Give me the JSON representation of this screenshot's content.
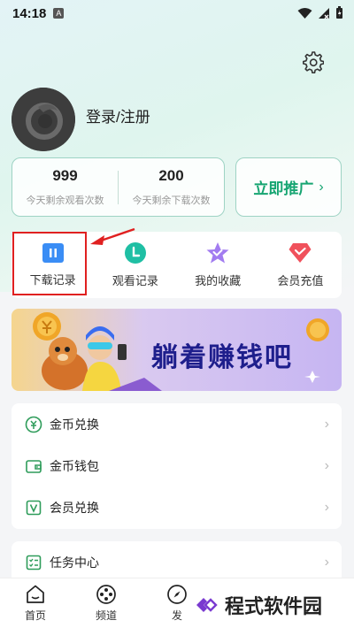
{
  "status_bar": {
    "time": "14:18",
    "badge": "A"
  },
  "profile": {
    "login_label": "登录/注册"
  },
  "stats": [
    {
      "value": "999",
      "label": "今天剩余观看次数"
    },
    {
      "value": "200",
      "label": "今天剩余下载次数"
    }
  ],
  "promote": {
    "label": "立即推广",
    "chevron": "›"
  },
  "quick_actions": [
    {
      "label": "下载记录",
      "icon": "download-record-icon"
    },
    {
      "label": "观看记录",
      "icon": "watch-history-icon"
    },
    {
      "label": "我的收藏",
      "icon": "favorites-icon"
    },
    {
      "label": "会员充值",
      "icon": "vip-recharge-icon"
    }
  ],
  "banner": {
    "text": "躺着赚钱吧"
  },
  "menu": [
    {
      "label": "金币兑换",
      "icon": "coin-exchange-icon"
    },
    {
      "label": "金币钱包",
      "icon": "wallet-icon"
    },
    {
      "label": "会员兑换",
      "icon": "vip-exchange-icon"
    }
  ],
  "menu2": [
    {
      "label": "任务中心",
      "icon": "task-center-icon"
    }
  ],
  "bottom_nav": [
    {
      "label": "首页",
      "icon": "home-icon"
    },
    {
      "label": "频道",
      "icon": "channel-icon"
    },
    {
      "label": "发",
      "icon": "discover-icon"
    }
  ],
  "watermark": {
    "text": "程式软件园"
  },
  "colors": {
    "accent": "#17a572",
    "highlight": "#e02020",
    "banner_text": "#1e1e8c"
  }
}
